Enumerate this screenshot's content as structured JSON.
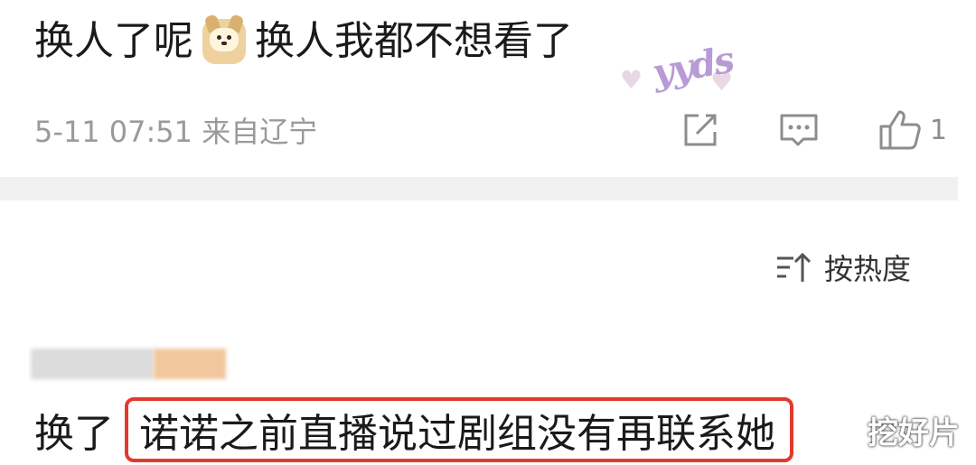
{
  "post": {
    "text_before": "换人了呢",
    "emoji_icon": "dog-face-emoji",
    "text_after": "换人我都不想看了",
    "sticker_text": "yyds"
  },
  "meta": {
    "timestamp_location": "5-11 07:51  来自辽宁",
    "share_icon": "share-icon",
    "comment_icon": "comment-icon",
    "like_icon": "thumbs-up-icon",
    "like_count": "1"
  },
  "sort": {
    "icon": "sort-icon",
    "label": "按热度"
  },
  "reply": {
    "prefix": "换了",
    "highlighted_text": "诺诺之前直播说过剧组没有再联系她"
  },
  "watermark": "挖好片",
  "colors": {
    "highlight_border": "#e23a2c",
    "meta_gray": "#9a9a9a",
    "divider": "#f1f1f1"
  }
}
